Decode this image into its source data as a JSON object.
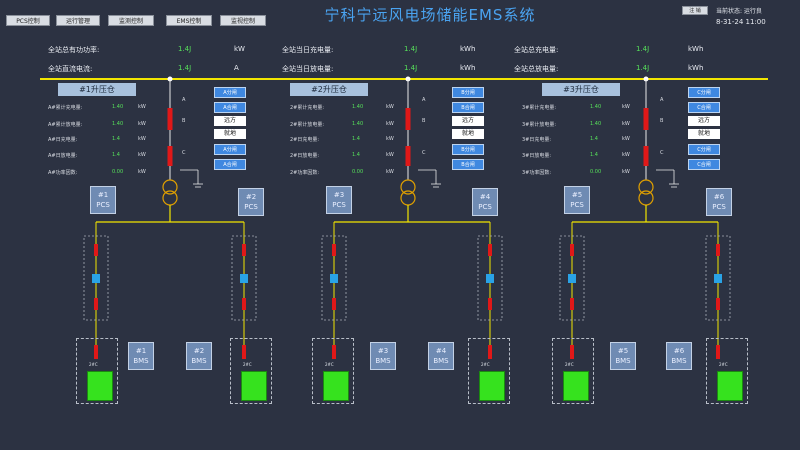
{
  "toolbar": {
    "buttons": [
      "PCS控制",
      "运行管理",
      "监测控制",
      "EMS控制",
      "监视控制"
    ]
  },
  "title": "宁科宁远风电场储能EMS系统",
  "header_right": {
    "user_button": "注 销",
    "status_label": "当前状态: 运行良",
    "datetime": "8-31-24 11:00"
  },
  "summary": {
    "left": [
      {
        "label": "全站总有功功率:",
        "value": "1.4J",
        "unit": "kW"
      },
      {
        "label": "全站直流电流:",
        "value": "1.4J",
        "unit": "A"
      }
    ],
    "middle": [
      {
        "label": "全站当日充电量:",
        "value": "1.4J",
        "unit": "kWh"
      },
      {
        "label": "全站当日放电量:",
        "value": "1.4J",
        "unit": "kWh"
      }
    ],
    "right": [
      {
        "label": "全站总充电量:",
        "value": "1.4J",
        "unit": "kWh"
      },
      {
        "label": "全站总放电量:",
        "value": "1.4J",
        "unit": "kWh"
      }
    ]
  },
  "stations": [
    {
      "name": "#1升压仓",
      "rows": [
        {
          "label": "A#累计充电量:",
          "value": "1.40",
          "unit": "kW"
        },
        {
          "label": "A#累计放电量:",
          "value": "1.40",
          "unit": "kW"
        },
        {
          "label": "A#日充电量:",
          "value": "1.4",
          "unit": "kW"
        },
        {
          "label": "A#日放电量:",
          "value": "1.4",
          "unit": "kW"
        },
        {
          "label": "A#功率因数:",
          "value": "0.00",
          "unit": "kW"
        }
      ],
      "buttons": [
        "A分闸",
        "A合闸",
        "A分闸",
        "A合闸"
      ],
      "boxes": [
        "远方",
        "就地"
      ],
      "switch_labels": [
        "A",
        "B",
        "C"
      ],
      "pcs": [
        {
          "num": "#1",
          "name": "PCS"
        },
        {
          "num": "#2",
          "name": "PCS"
        }
      ],
      "bms": [
        {
          "num": "#1",
          "name": "BMS"
        },
        {
          "num": "#2",
          "name": "BMS"
        }
      ],
      "battery_labels": [
        "2#C",
        "2#C",
        "2#C",
        "2#C"
      ]
    },
    {
      "name": "#2升压仓",
      "rows": [
        {
          "label": "2#累计充电量:",
          "value": "1.40",
          "unit": "kW"
        },
        {
          "label": "2#累计放电量:",
          "value": "1.40",
          "unit": "kW"
        },
        {
          "label": "2#日充电量:",
          "value": "1.4",
          "unit": "kW"
        },
        {
          "label": "2#日放电量:",
          "value": "1.4",
          "unit": "kW"
        },
        {
          "label": "2#功率因数:",
          "value": "0.00",
          "unit": "kW"
        }
      ],
      "buttons": [
        "B分闸",
        "B合闸",
        "B分闸",
        "B合闸"
      ],
      "boxes": [
        "远方",
        "就地"
      ],
      "switch_labels": [
        "A",
        "B",
        "C"
      ],
      "pcs": [
        {
          "num": "#3",
          "name": "PCS"
        },
        {
          "num": "#4",
          "name": "PCS"
        }
      ],
      "bms": [
        {
          "num": "#3",
          "name": "BMS"
        },
        {
          "num": "#4",
          "name": "BMS"
        }
      ],
      "battery_labels": [
        "2#C",
        "2#C",
        "2#C",
        "2#C"
      ]
    },
    {
      "name": "#3升压仓",
      "rows": [
        {
          "label": "3#累计充电量:",
          "value": "1.40",
          "unit": "kW"
        },
        {
          "label": "3#累计放电量:",
          "value": "1.40",
          "unit": "kW"
        },
        {
          "label": "3#日充电量:",
          "value": "1.4",
          "unit": "kW"
        },
        {
          "label": "3#日放电量:",
          "value": "1.4",
          "unit": "kW"
        },
        {
          "label": "3#功率因数:",
          "value": "0.00",
          "unit": "kW"
        }
      ],
      "buttons": [
        "C分闸",
        "C合闸",
        "C分闸",
        "C合闸"
      ],
      "boxes": [
        "远方",
        "就地"
      ],
      "switch_labels": [
        "A",
        "B",
        "C"
      ],
      "pcs": [
        {
          "num": "#5",
          "name": "PCS"
        },
        {
          "num": "#6",
          "name": "PCS"
        }
      ],
      "bms": [
        {
          "num": "#5",
          "name": "BMS"
        },
        {
          "num": "#6",
          "name": "BMS"
        }
      ],
      "battery_labels": [
        "2#C",
        "2#C",
        "2#C",
        "2#C"
      ]
    }
  ],
  "colors": {
    "background": "#2c3242",
    "busbar": "#f2e600",
    "feeder": "#f2e600",
    "breaker_red": "#e01818",
    "transformer": "#e0a000",
    "battery_green": "#36e21e",
    "button_blue": "#3f88e0",
    "title_blue": "#4aa3f0",
    "value_green": "#56e05a"
  }
}
